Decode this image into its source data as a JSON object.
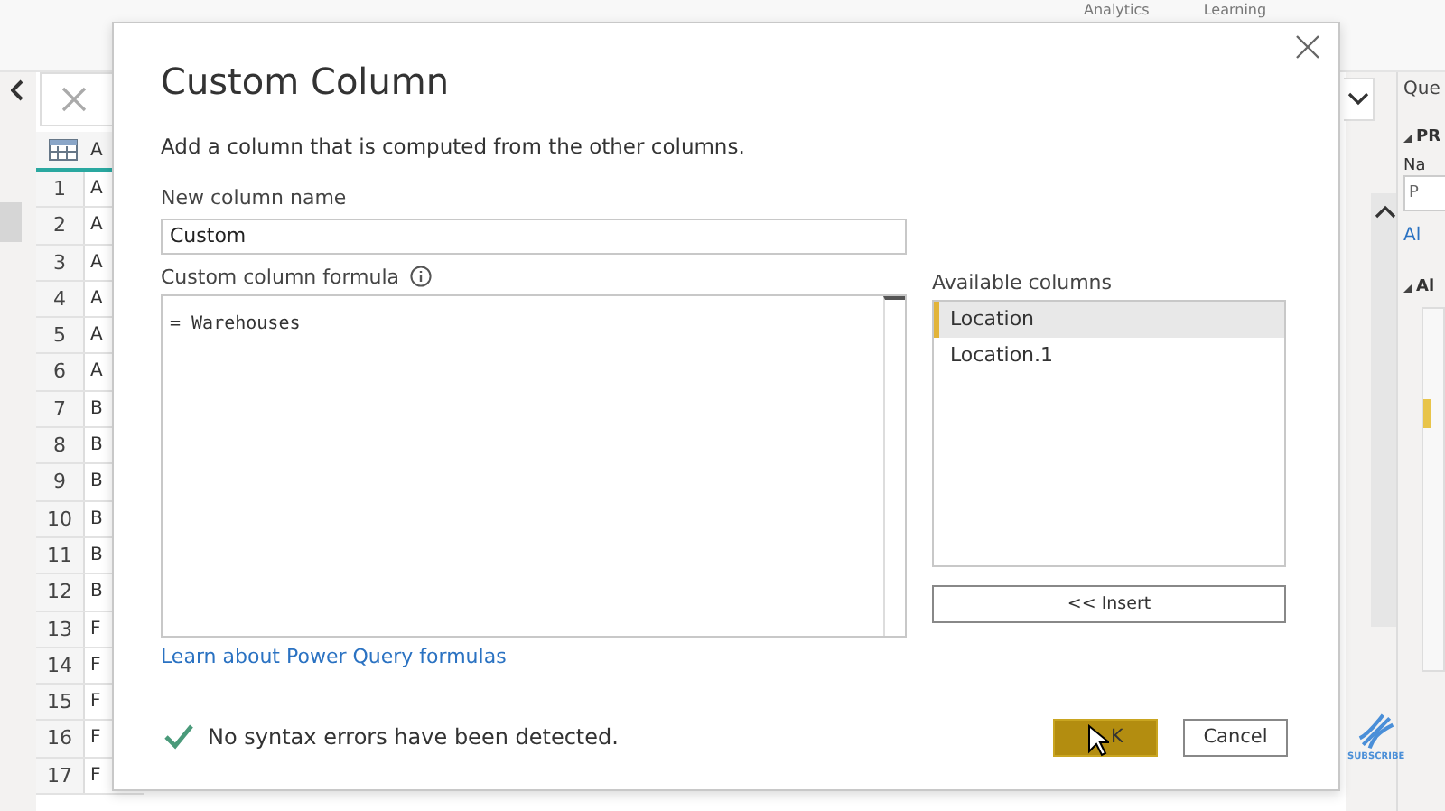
{
  "ribbon": {
    "tabs": [
      "Analytics",
      "Learning"
    ]
  },
  "grid": {
    "column_1": "A",
    "rows": [
      {
        "number": "1",
        "cell": "A"
      },
      {
        "number": "2",
        "cell": "A"
      },
      {
        "number": "3",
        "cell": "A"
      },
      {
        "number": "4",
        "cell": "A"
      },
      {
        "number": "5",
        "cell": "A"
      },
      {
        "number": "6",
        "cell": "A"
      },
      {
        "number": "7",
        "cell": "B"
      },
      {
        "number": "8",
        "cell": "B"
      },
      {
        "number": "9",
        "cell": "B"
      },
      {
        "number": "10",
        "cell": "B"
      },
      {
        "number": "11",
        "cell": "B"
      },
      {
        "number": "12",
        "cell": "B"
      },
      {
        "number": "13",
        "cell": "F"
      },
      {
        "number": "14",
        "cell": "F"
      },
      {
        "number": "15",
        "cell": "F"
      },
      {
        "number": "16",
        "cell": "F"
      },
      {
        "number": "17",
        "cell": "F"
      }
    ]
  },
  "query_settings": {
    "title": "Que",
    "section_1": "PR",
    "name_label": "Na",
    "name_value": "P",
    "link": "Al",
    "section_2": "Al"
  },
  "dialog": {
    "title": "Custom Column",
    "description": "Add a column that is computed from the other columns.",
    "name_label": "New column name",
    "name_value": "Custom",
    "formula_label": "Custom column formula",
    "formula_value": "= Warehouses",
    "available_label": "Available columns",
    "available_columns": [
      {
        "name": "Location",
        "selected": true
      },
      {
        "name": "Location.1",
        "selected": false
      }
    ],
    "insert_button": "<< Insert",
    "learn_link": "Learn about Power Query formulas",
    "status": "No syntax errors have been detected.",
    "status_ok": true,
    "ok_button": "K",
    "cancel_button": "Cancel"
  },
  "watermark_logo": {
    "label": "SUBSCRIBE"
  }
}
